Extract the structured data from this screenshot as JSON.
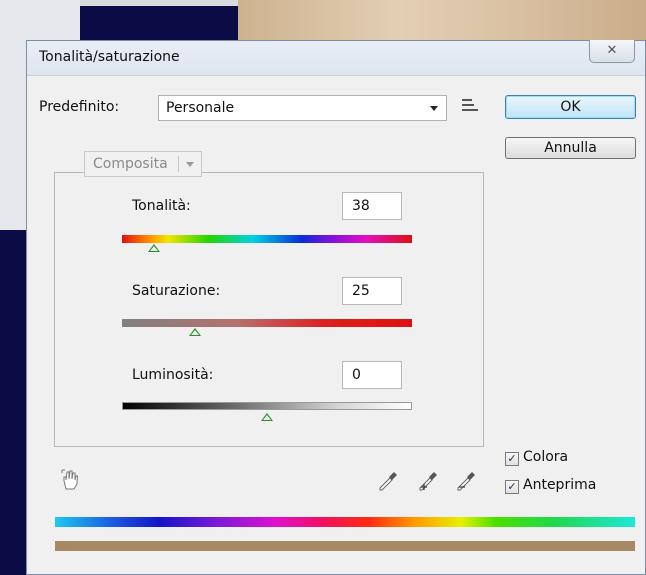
{
  "dialog": {
    "title": "Tonalità/saturazione",
    "close_glyph": "✕"
  },
  "preset": {
    "label": "Predefinito:",
    "value": "Personale",
    "menu_icon": "preset-options-icon"
  },
  "buttons": {
    "ok": "OK",
    "cancel": "Annulla"
  },
  "channel": {
    "value": "Composita"
  },
  "sliders": {
    "hue": {
      "label": "Tonalità:",
      "value": "38",
      "thumb_fraction": 0.11
    },
    "saturation": {
      "label": "Saturazione:",
      "value": "25",
      "thumb_fraction": 0.25
    },
    "lightness": {
      "label": "Luminosità:",
      "value": "0",
      "thumb_fraction": 0.5
    }
  },
  "tools": {
    "hand": "targeted-adjustment-icon",
    "droppers": [
      "eyedropper-icon",
      "eyedropper-plus-icon",
      "eyedropper-minus-icon"
    ]
  },
  "options": {
    "colorize": {
      "label": "Colora",
      "checked": true
    },
    "preview": {
      "label": "Anteprima",
      "checked": true
    }
  },
  "colors": {
    "ok_border": "#3c7fb1",
    "thumb": "#2c8a2c",
    "colorize_bar": "#a68a66"
  }
}
